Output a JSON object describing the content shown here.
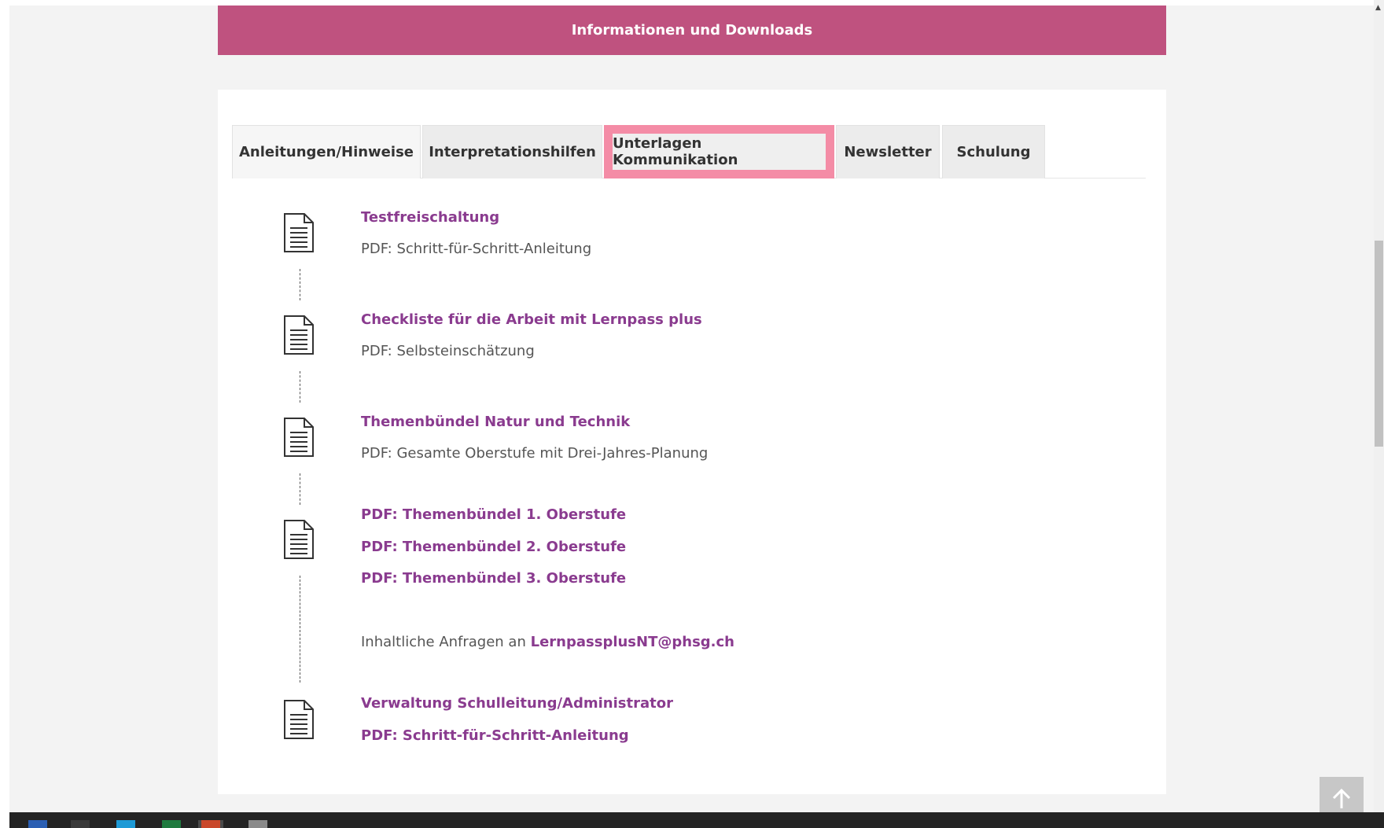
{
  "header": {
    "title": "Informationen und Downloads"
  },
  "tabs": [
    {
      "label": "Anleitungen/Hinweise",
      "state": "active"
    },
    {
      "label": "Interpretationshilfen",
      "state": "normal"
    },
    {
      "label": "Unterlagen Kommunikation",
      "state": "highlighted"
    },
    {
      "label": "Newsletter",
      "state": "normal"
    },
    {
      "label": "Schulung",
      "state": "normal"
    }
  ],
  "items": [
    {
      "link": "Testfreischaltung",
      "desc": "PDF: Schritt-für-Schritt-Anleitung"
    },
    {
      "link": "Checkliste für die Arbeit mit Lernpass plus",
      "desc": "PDF: Selbsteinschätzung"
    },
    {
      "link": "Themenbündel Natur und Technik",
      "desc": "PDF: Gesamte Oberstufe mit Drei-Jahres-Planung"
    },
    {
      "links": [
        "PDF: Themenbündel 1. Oberstufe",
        "PDF: Themenbündel 2. Oberstufe",
        "PDF: Themenbündel 3. Oberstufe"
      ],
      "contact_prefix": "Inhaltliche Anfragen an",
      "contact_email": "LernpassplusNT@phsg.ch"
    },
    {
      "links": [
        "Verwaltung Schulleitung/Administrator",
        "PDF: Schritt-für-Schritt-Anleitung"
      ]
    }
  ],
  "icons": {
    "document": "document-icon",
    "back_to_top": "arrow-up-icon",
    "scroll_up": "scroll-up-arrow-icon"
  },
  "colors": {
    "header_bg": "#bf527f",
    "link": "#8a3b8f",
    "highlight": "#f48ca6",
    "taskbar": "#242424"
  }
}
